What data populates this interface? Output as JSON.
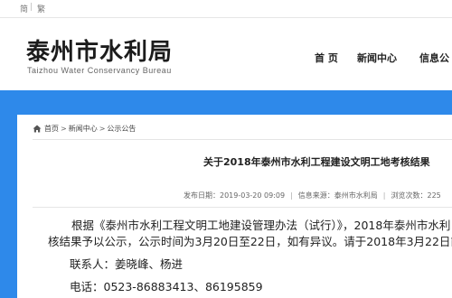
{
  "topbar": {
    "simplified": "简",
    "separator": "|",
    "traditional": "繁"
  },
  "header": {
    "site_name": "泰州市水利局",
    "site_name_en": "Taizhou Water Conservancy Bureau",
    "nav": [
      "首 页",
      "新闻中心",
      "信息公"
    ]
  },
  "colors": {
    "band": "#2e89ea"
  },
  "breadcrumb": {
    "items": [
      "首页",
      "新闻中心",
      "公示公告"
    ],
    "separator": ">"
  },
  "article": {
    "title": "关于2018年泰州市水利工程建设文明工地考核结果",
    "meta": {
      "publish_time": "发布日期：2019-03-20 09:09",
      "source": "信息来源：泰州市水利局",
      "views": "浏览次数：225"
    },
    "paragraphs": [
      "根据《泰州市水利工程文明工地建设管理办法（试行）》，2018年泰州市水利",
      "核结果予以公示，公示时间为3月20日至22日，如有异议。请于2018年3月22日前",
      "联系人：姜晓峰、杨进",
      "电话：0523-86883413、86195859"
    ]
  }
}
